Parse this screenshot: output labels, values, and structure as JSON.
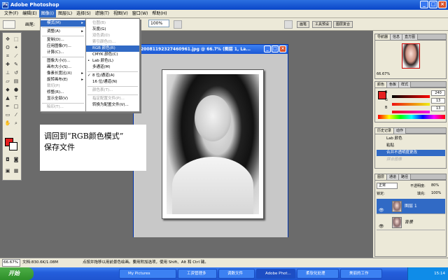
{
  "app": {
    "title": "Adobe Photoshop"
  },
  "menubar": {
    "items": [
      "文件(F)",
      "编辑(E)",
      "图像(I)",
      "图层(L)",
      "选择(S)",
      "滤镜(T)",
      "视图(V)",
      "窗口(W)",
      "帮助(H)"
    ],
    "active_index": 2
  },
  "options": {
    "brush_label": "画笔:",
    "zoom_value": "100%",
    "wells": [
      "画笔",
      "工具预设",
      "图层复合"
    ]
  },
  "image_menu": {
    "items": [
      "模式(M)",
      "调整(A)",
      "复制(D)...",
      "应用图像(Y)...",
      "计算(C)...",
      "图像大小(I)...",
      "画布大小(S)...",
      "像素长宽比(X)",
      "旋转画布(E)",
      "裁切(P)",
      "修整(R)...",
      "显示全部(V)",
      "陷印(T)..."
    ]
  },
  "mode_menu": {
    "items": [
      "位图(B)",
      "灰度(G)",
      "双色调(D)",
      "索引颜色(I)...",
      "RGB 颜色(R)",
      "CMYK 颜色(C)",
      "Lab 颜色(L)",
      "多通道(M)",
      "8 位/通道(A)",
      "16 位/通道(N)",
      "颜色表(T)...",
      "指定配置文件(P)...",
      "转换为配置文件(V)..."
    ]
  },
  "document": {
    "title": "20081192327460961.jpg @ 66.7% (图层 1, La..."
  },
  "note": {
    "line1": "调回到“RGB颜色模式”",
    "line2": "保存文件"
  },
  "navigator": {
    "tabs": [
      "导航器",
      "信息",
      "直方图"
    ],
    "zoom": "66.67%"
  },
  "color_panel": {
    "tabs": [
      "颜色",
      "色板",
      "样式"
    ],
    "channels": [
      {
        "label": "R",
        "value": "240"
      },
      {
        "label": "G",
        "value": "13"
      },
      {
        "label": "B",
        "value": "13"
      }
    ],
    "fg_color": "#e51f1f"
  },
  "history": {
    "tabs": [
      "历史记录",
      "动作"
    ],
    "items": [
      "Lab 颜色",
      "粘贴",
      "合并不透明度更改",
      "拼合图像"
    ],
    "selected_index": 2
  },
  "layers": {
    "tabs": [
      "图层",
      "通道",
      "路径"
    ],
    "mode": "正常",
    "opacity_label": "不透明度:",
    "opacity": "80%",
    "lock_label": "锁定:",
    "fill_label": "填充:",
    "fill": "100%",
    "items": [
      {
        "name": "图层 1",
        "selected": true
      },
      {
        "name": "背景",
        "selected": false
      }
    ]
  },
  "status": {
    "zoom": "66.67%",
    "doc": "文档:830.6K/1.08M",
    "hint": "点按并拖移以用前景色绘画。要用附加选项，使用 Shift、Alt 和 Ctrl 键。"
  },
  "taskbar": {
    "start": "开始",
    "tasks": [
      "My Pictures",
      "工资管理多",
      "调数文件",
      "Adobe Phot...",
      "柔软化处理",
      "美丽的工作"
    ],
    "active_index": 3,
    "clock": "15:14"
  }
}
